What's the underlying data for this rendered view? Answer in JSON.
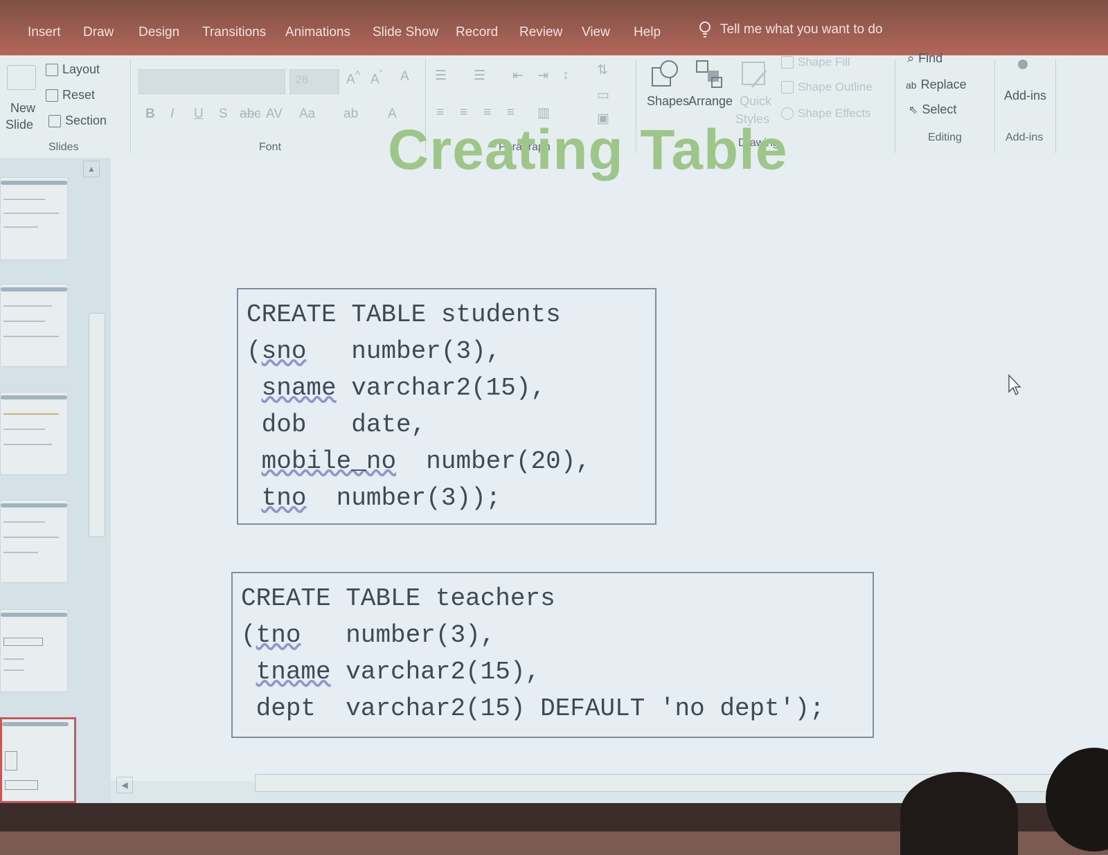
{
  "tabs": [
    "Insert",
    "Draw",
    "Design",
    "Transitions",
    "Animations",
    "Slide Show",
    "Record",
    "Review",
    "View",
    "Help"
  ],
  "tell_me": "Tell me what you want to do",
  "ribbon": {
    "slides": {
      "new_slide": "New",
      "new_slide2": "Slide",
      "layout": "Layout",
      "reset": "Reset",
      "section": "Section",
      "label": "Slides"
    },
    "font": {
      "size": "28",
      "label": "Font"
    },
    "paragraph": {
      "label": "Paragraph"
    },
    "drawing": {
      "shapes": "Shapes",
      "arrange": "Arrange",
      "quick_styles": "Quick",
      "quick_styles2": "Styles",
      "shape_fill": "Shape Fill",
      "shape_outline": "Shape Outline",
      "shape_effects": "Shape Effects",
      "label": "Drawing"
    },
    "editing": {
      "find": "Find",
      "replace": "Replace",
      "select": "Select",
      "label": "Editing"
    },
    "addins": {
      "button": "Add-ins",
      "label": "Add-ins"
    }
  },
  "slide": {
    "title": "Creating Table",
    "code_students": {
      "line1": "CREATE TABLE students",
      "sno": "sno",
      "sno_type": "number(3),",
      "sname": "sname",
      "sname_type": "varchar2(15),",
      "dob": "dob",
      "dob_type": "date,",
      "mobile": "mobile_no",
      "mobile_type": "number(20),",
      "tno": "tno",
      "tno_type": "number(3));"
    },
    "code_teachers": {
      "line1": "CREATE TABLE teachers",
      "tno": "tno",
      "tno_type": "number(3),",
      "tname": "tname",
      "tname_type": "varchar2(15),",
      "dept": "dept",
      "dept_type": "varchar2(15) DEFAULT 'no dept');"
    }
  }
}
